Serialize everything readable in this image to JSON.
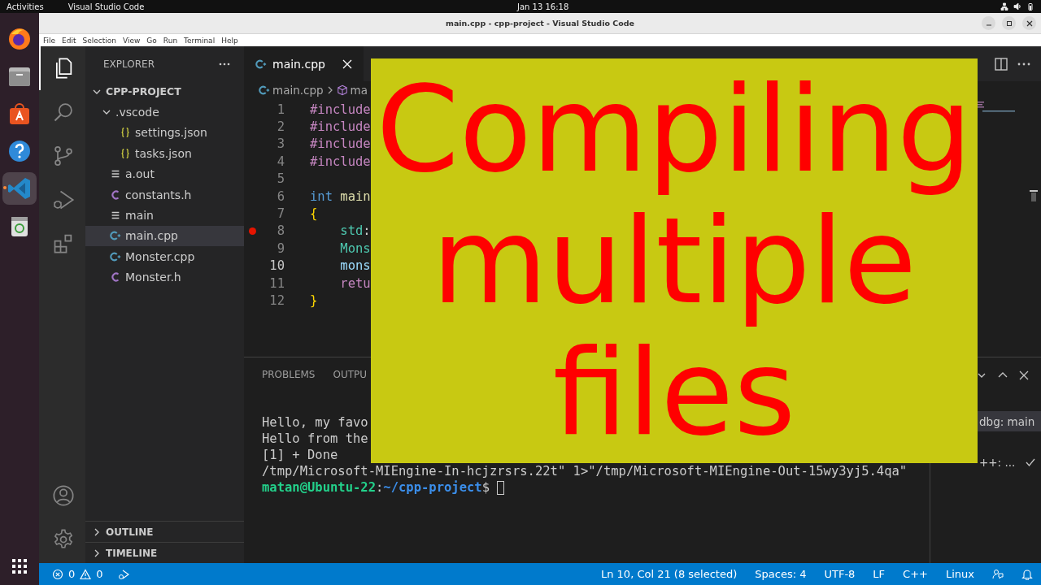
{
  "topbar": {
    "activities": "Activities",
    "app": "Visual Studio Code",
    "clock": "Jan 13  16:18"
  },
  "dock": [
    {
      "kind": "browser",
      "selected": false
    },
    {
      "kind": "files",
      "selected": false
    },
    {
      "kind": "store",
      "selected": false
    },
    {
      "kind": "help",
      "selected": false
    },
    {
      "kind": "code",
      "selected": true
    },
    {
      "kind": "trash",
      "selected": false
    }
  ],
  "window": {
    "title": "main.cpp - cpp-project - Visual Studio Code"
  },
  "menu": [
    "File",
    "Edit",
    "Selection",
    "View",
    "Go",
    "Run",
    "Terminal",
    "Help"
  ],
  "activity_bar": [
    {
      "kind": "explorer",
      "selected": true
    },
    {
      "kind": "search",
      "selected": false
    },
    {
      "kind": "source-control",
      "selected": false
    },
    {
      "kind": "debug",
      "selected": false
    },
    {
      "kind": "extensions",
      "selected": false
    }
  ],
  "sidebar": {
    "title": "EXPLORER",
    "tree": [
      {
        "label": "CPP-PROJECT",
        "kind": "root",
        "expanded": true,
        "selected": false,
        "children": [
          {
            "label": ".vscode",
            "kind": "folder",
            "expanded": true,
            "selected": false,
            "children": [
              {
                "label": "settings.json",
                "kind": "json",
                "selected": false
              },
              {
                "label": "tasks.json",
                "kind": "json",
                "selected": false
              }
            ]
          },
          {
            "label": "a.out",
            "kind": "text",
            "selected": false
          },
          {
            "label": "constants.h",
            "kind": "h",
            "selected": false
          },
          {
            "label": "main",
            "kind": "text",
            "selected": false
          },
          {
            "label": "main.cpp",
            "kind": "cpp",
            "selected": true
          },
          {
            "label": "Monster.cpp",
            "kind": "cpp",
            "selected": false
          },
          {
            "label": "Monster.h",
            "kind": "h",
            "selected": false
          }
        ]
      }
    ],
    "sections": [
      {
        "label": "OUTLINE",
        "expanded": false
      },
      {
        "label": "TIMELINE",
        "expanded": false
      }
    ]
  },
  "tabs": [
    {
      "label": "main.cpp",
      "kind": "cpp",
      "selected": true
    }
  ],
  "breadcrumb": [
    {
      "label": "main.cpp",
      "kind": "cpp"
    },
    {
      "label": "ma",
      "kind": "symbol"
    }
  ],
  "code": [
    {
      "number": "1",
      "breakpoint": false,
      "current": false,
      "tokens": [
        {
          "text": "#include",
          "kind": "keyword"
        }
      ]
    },
    {
      "number": "2",
      "breakpoint": false,
      "current": false,
      "tokens": [
        {
          "text": "#include",
          "kind": "keyword"
        }
      ]
    },
    {
      "number": "3",
      "breakpoint": false,
      "current": false,
      "tokens": [
        {
          "text": "#include",
          "kind": "keyword"
        }
      ]
    },
    {
      "number": "4",
      "breakpoint": false,
      "current": false,
      "tokens": [
        {
          "text": "#include",
          "kind": "keyword"
        }
      ]
    },
    {
      "number": "5",
      "breakpoint": false,
      "current": false
    },
    {
      "number": "6",
      "breakpoint": false,
      "current": false,
      "tokens": [
        {
          "text": "int",
          "kind": "storage"
        },
        {
          "text": " main",
          "kind": "func"
        }
      ]
    },
    {
      "number": "7",
      "breakpoint": false,
      "current": false,
      "tokens": [
        {
          "text": "{",
          "kind": "brace"
        }
      ]
    },
    {
      "number": "8",
      "breakpoint": true,
      "current": false,
      "tokens": [
        {
          "text": "    std",
          "kind": "type"
        },
        {
          "text": ":",
          "kind": "plain"
        }
      ]
    },
    {
      "number": "9",
      "breakpoint": false,
      "current": false,
      "tokens": [
        {
          "text": "    Mons",
          "kind": "type"
        }
      ]
    },
    {
      "number": "10",
      "breakpoint": false,
      "current": true,
      "tokens": [
        {
          "text": "    mons",
          "kind": "var"
        }
      ]
    },
    {
      "number": "11",
      "breakpoint": false,
      "current": false,
      "tokens": [
        {
          "text": "    retu",
          "kind": "keyword"
        }
      ]
    },
    {
      "number": "12",
      "breakpoint": false,
      "current": false,
      "tokens": [
        {
          "text": "}",
          "kind": "brace"
        }
      ]
    }
  ],
  "panel": {
    "tabs": [
      {
        "label": "PROBLEMS",
        "selected": false
      },
      {
        "label": "OUTPU",
        "selected": false
      }
    ],
    "terminal": [
      "Hello, my favo",
      "Hello from the",
      "[1] + Done",
      "/tmp/Microsoft-MIEngine-In-hcjzrsrs.22t\" 1>\"/tmp/Microsoft-MIEngine-Out-15wy3yj5.4qa\""
    ],
    "prompt": {
      "user": "matan@Ubuntu-22",
      "separator": ":",
      "path": "~/cpp-project",
      "symbol": "$"
    },
    "terminals": [
      {
        "label": "dbg: main",
        "selected": true
      },
      {
        "label": "++: ...",
        "selected": false,
        "done": true
      }
    ]
  },
  "status_bar": {
    "errors": "0",
    "warnings": "0",
    "right": [
      "Ln 10, Col 21 (8 selected)",
      "Spaces: 4",
      "UTF-8",
      "LF",
      "C++",
      "Linux"
    ]
  },
  "overlay": {
    "lines": [
      "Compiling",
      "multiple",
      "files"
    ]
  }
}
